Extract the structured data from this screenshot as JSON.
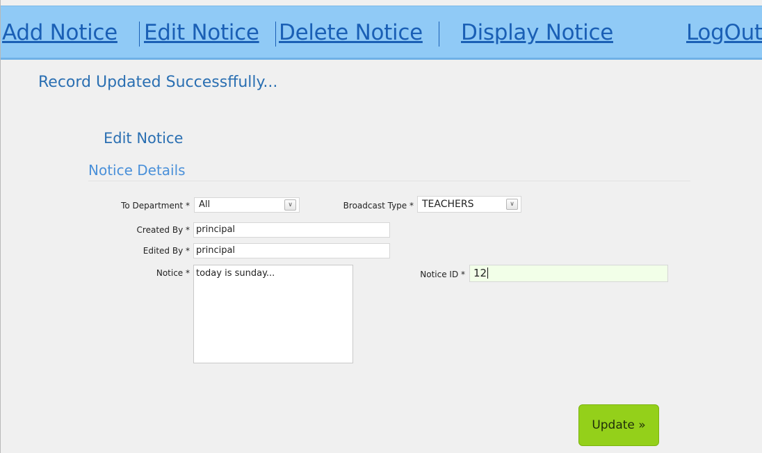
{
  "nav": {
    "items": [
      {
        "label": "Add Notice"
      },
      {
        "label": "Edit Notice"
      },
      {
        "label": "Delete Notice"
      },
      {
        "label": "Display Notice"
      },
      {
        "label": "LogOut"
      }
    ]
  },
  "status_message": "Record Updated Successffully...",
  "page_title": "Edit Notice",
  "section_title": "Notice Details",
  "form": {
    "to_department": {
      "label": "To Department *",
      "value": "All"
    },
    "broadcast_type": {
      "label": "Broadcast Type *",
      "value": "TEACHERS"
    },
    "created_by": {
      "label": "Created By *",
      "value": "principal"
    },
    "edited_by": {
      "label": "Edited By *",
      "value": "principal"
    },
    "notice": {
      "label": "Notice *",
      "value": "today is sunday..."
    },
    "notice_id": {
      "label": "Notice ID *",
      "value": "12"
    },
    "submit_label": "Update »"
  },
  "colors": {
    "nav_bg": "#90caf6",
    "link": "#1a5fb5",
    "heading": "#2a6fb2",
    "button_bg": "#94d01a",
    "id_field_bg": "#f2ffe8"
  },
  "icons": {
    "select_arrow": "chevron-down-icon"
  }
}
